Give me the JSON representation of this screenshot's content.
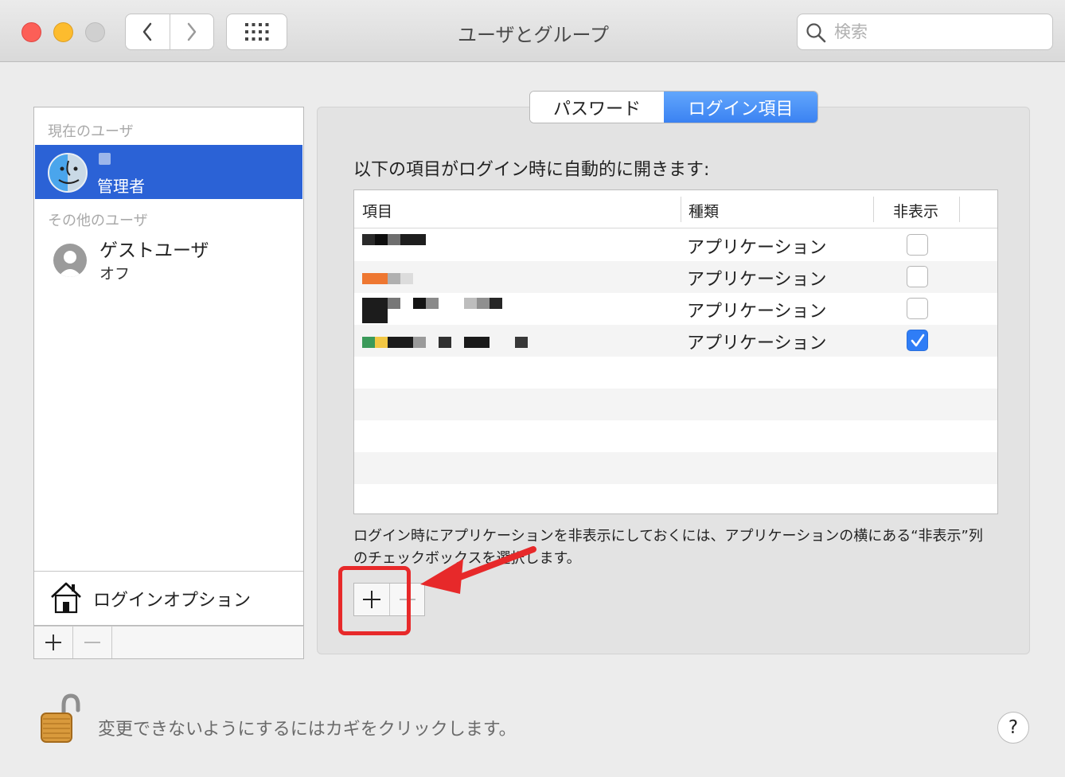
{
  "window": {
    "title": "ユーザとグループ"
  },
  "toolbar": {
    "search_placeholder": "検索"
  },
  "sidebar": {
    "current_users_header": "現在のユーザ",
    "current_user": {
      "role": "管理者"
    },
    "other_users_header": "その他のユーザ",
    "guest_user": {
      "name": "ゲストユーザ",
      "status": "オフ"
    },
    "login_options_label": "ログインオプション",
    "add_label": "+",
    "remove_label": "−"
  },
  "tabs": {
    "password": "パスワード",
    "login_items": "ログイン項目"
  },
  "panel": {
    "heading": "以下の項目がログイン時に自動的に開きます:",
    "columns": {
      "item": "項目",
      "kind": "種類",
      "hide": "非表示"
    },
    "rows": [
      {
        "kind": "アプリケーション",
        "hidden": false
      },
      {
        "kind": "アプリケーション",
        "hidden": false
      },
      {
        "kind": "アプリケーション",
        "hidden": false
      },
      {
        "kind": "アプリケーション",
        "hidden": true
      }
    ],
    "hint": "ログイン時にアプリケーションを非表示にしておくには、アプリケーションの横にある“非表示”列のチェックボックスを選択します。",
    "add_label": "+",
    "remove_label": "−"
  },
  "footer": {
    "lock_text": "変更できないようにするにはカギをクリックします。",
    "help_label": "?"
  },
  "colors": {
    "selection": "#2b62d6",
    "accent": "#3b82f2",
    "annotation": "#e7292a"
  }
}
